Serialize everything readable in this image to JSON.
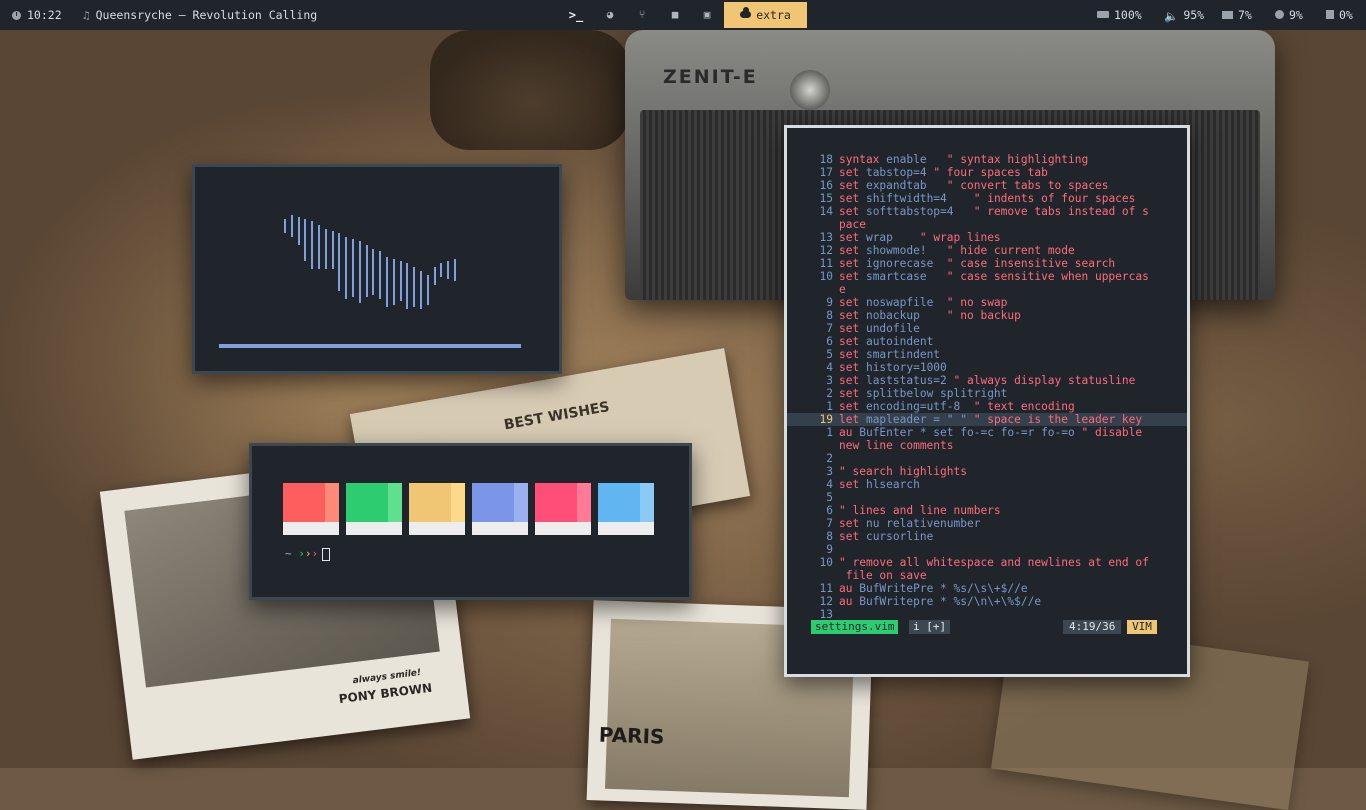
{
  "topbar": {
    "time": "10:22",
    "now_playing": "Queensryche – Revolution Calling",
    "workspaces": [
      {
        "name": "terminal",
        "glyph": ">_"
      },
      {
        "name": "browser",
        "glyph": "◕"
      },
      {
        "name": "git",
        "glyph": "⑂"
      },
      {
        "name": "folder",
        "glyph": "■"
      },
      {
        "name": "media",
        "glyph": "▣"
      }
    ],
    "active_workspace": "extra",
    "battery": "100%",
    "volume": "95%",
    "memory": "7%",
    "cpu": "9%",
    "disk": "0%"
  },
  "wallpaper": {
    "camera_label": "ZENIT-E",
    "photo_captions": [
      "always smile!",
      "PONY BROWN",
      "PARIS",
      "BEST WISHES"
    ]
  },
  "colors_window": {
    "swatches": [
      {
        "main": "#ff5e5e",
        "light": "#ff8a7a"
      },
      {
        "main": "#2ecc71",
        "light": "#5ee08d"
      },
      {
        "main": "#f0c674",
        "light": "#ffd98a"
      },
      {
        "main": "#7b96e8",
        "light": "#9ab0f0"
      },
      {
        "main": "#ff4f79",
        "light": "#ff7a97"
      },
      {
        "main": "#61b5f0",
        "light": "#8cc9f5"
      }
    ],
    "prompt": {
      "tilde": "~",
      "arrows": "›››"
    }
  },
  "vim": {
    "lines": [
      {
        "num": "18",
        "kw": "syntax",
        "rest": " enable   ",
        "comment": "\" syntax highlighting"
      },
      {
        "num": "17",
        "kw": "set",
        "rest": " tabstop=4 ",
        "comment": "\" four spaces tab"
      },
      {
        "num": "16",
        "kw": "set",
        "rest": " expandtab   ",
        "comment": "\" convert tabs to spaces"
      },
      {
        "num": "15",
        "kw": "set",
        "rest": " shiftwidth=4    ",
        "comment": "\" indents of four spaces"
      },
      {
        "num": "14",
        "kw": "set",
        "rest": " softtabstop=4   ",
        "comment": "\" remove tabs instead of s"
      },
      {
        "num": "",
        "kw": "",
        "rest": "",
        "comment": "pace"
      },
      {
        "num": "13",
        "kw": "set",
        "rest": " wrap    ",
        "comment": "\" wrap lines"
      },
      {
        "num": "12",
        "kw": "set",
        "rest": " showmode!   ",
        "comment": "\" hide current mode"
      },
      {
        "num": "11",
        "kw": "set",
        "rest": " ignorecase  ",
        "comment": "\" case insensitive search"
      },
      {
        "num": "10",
        "kw": "set",
        "rest": " smartcase   ",
        "comment": "\" case sensitive when uppercas"
      },
      {
        "num": "",
        "kw": "",
        "rest": "",
        "comment": "e"
      },
      {
        "num": "9",
        "kw": "set",
        "rest": " noswapfile  ",
        "comment": "\" no swap"
      },
      {
        "num": "8",
        "kw": "set",
        "rest": " nobackup    ",
        "comment": "\" no backup"
      },
      {
        "num": "7",
        "kw": "set",
        "rest": " undofile",
        "comment": ""
      },
      {
        "num": "6",
        "kw": "set",
        "rest": " autoindent",
        "comment": ""
      },
      {
        "num": "5",
        "kw": "set",
        "rest": " smartindent",
        "comment": ""
      },
      {
        "num": "4",
        "kw": "set",
        "rest": " history=1000",
        "comment": ""
      },
      {
        "num": "3",
        "kw": "set",
        "rest": " laststatus=2 ",
        "comment": "\" always display statusline"
      },
      {
        "num": "2",
        "kw": "set",
        "rest": " splitbelow splitright",
        "comment": ""
      },
      {
        "num": "1",
        "kw": "set",
        "rest": " encoding=utf-8  ",
        "comment": "\" text encoding"
      },
      {
        "num": "19",
        "kw": "let",
        "rest": " mapleader = \" \" ",
        "comment": "\" space is the leader key",
        "current": true
      },
      {
        "num": "1",
        "kw": "au",
        "rest": " BufEnter * set fo-=c fo-=r fo-=o ",
        "comment": "\" disable"
      },
      {
        "num": "",
        "kw": "",
        "rest": "",
        "comment": "new line comments"
      },
      {
        "num": "2",
        "kw": "",
        "rest": "",
        "comment": ""
      },
      {
        "num": "3",
        "kw": "",
        "rest": "",
        "comment": "\" search highlights"
      },
      {
        "num": "4",
        "kw": "set",
        "rest": " hlsearch",
        "comment": ""
      },
      {
        "num": "5",
        "kw": "",
        "rest": "",
        "comment": ""
      },
      {
        "num": "6",
        "kw": "",
        "rest": "",
        "comment": "\" lines and line numbers"
      },
      {
        "num": "7",
        "kw": "set",
        "rest": " nu relativenumber",
        "comment": ""
      },
      {
        "num": "8",
        "kw": "set",
        "rest": " cursorline",
        "comment": ""
      },
      {
        "num": "9",
        "kw": "",
        "rest": "",
        "comment": ""
      },
      {
        "num": "10",
        "kw": "",
        "rest": "",
        "comment": "\" remove all whitespace and newlines at end of"
      },
      {
        "num": "",
        "kw": "",
        "rest": "",
        "comment": " file on save"
      },
      {
        "num": "11",
        "kw": "au",
        "rest": " BufWritePre * %s/\\s\\+$//e",
        "comment": ""
      },
      {
        "num": "12",
        "kw": "au",
        "rest": " BufWritepre * %s/\\n\\+\\%$//e",
        "comment": ""
      },
      {
        "num": "13",
        "kw": "",
        "rest": "",
        "comment": ""
      }
    ],
    "status": {
      "file": "settings.vim",
      "mode": "i [+]",
      "position": "4:19/36",
      "filetype": "VIM"
    }
  }
}
